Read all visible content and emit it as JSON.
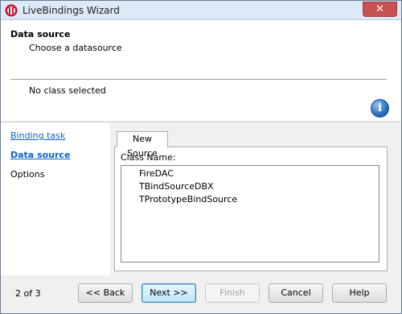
{
  "window": {
    "title": "LiveBindings Wizard",
    "close_glyph": "✕"
  },
  "header": {
    "title": "Data source",
    "subtitle": "Choose a datasource",
    "status": "No class selected",
    "info_glyph": "i"
  },
  "nav": {
    "items": [
      {
        "label": "Binding task",
        "state": "link"
      },
      {
        "label": "Data source",
        "state": "active"
      },
      {
        "label": "Options",
        "state": "plain"
      }
    ]
  },
  "content": {
    "tab_label": "New Source",
    "class_name_label": "Class Name:",
    "classes": [
      "FireDAC",
      "TBindSourceDBX",
      "TPrototypeBindSource"
    ]
  },
  "footer": {
    "page_count": "2 of 3",
    "back_label": "<< Back",
    "next_label": "Next >>",
    "finish_label": "Finish",
    "cancel_label": "Cancel",
    "help_label": "Help"
  },
  "colors": {
    "link": "#0a62c9",
    "close_button": "#c75050",
    "default_button_border": "#3c7fb1"
  }
}
